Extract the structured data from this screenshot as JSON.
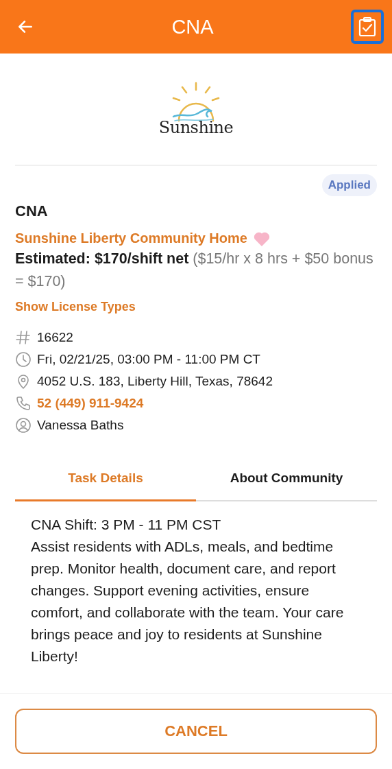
{
  "header": {
    "title": "CNA",
    "checklist_highlighted": true
  },
  "logo": {
    "text": "Sunshine"
  },
  "status_badge": "Applied",
  "job": {
    "title": "CNA",
    "community": "Sunshine Liberty Community Home",
    "favorite": true,
    "estimate": "**Estimated: $170/shift net** ($15/hr x 8 hrs + $50 bonus = $170)",
    "license_link": "Show License Types"
  },
  "details": [
    {
      "kind": "id",
      "text": "16622"
    },
    {
      "kind": "time",
      "text": "Fri, 02/21/25, 03:00 PM - 11:00 PM CT"
    },
    {
      "kind": "address",
      "text": "4052 U.S. 183, Liberty Hill, Texas, 78642"
    },
    {
      "kind": "phone",
      "text": "52 (449) 911-9424"
    },
    {
      "kind": "contact",
      "text": "Vanessa Baths"
    }
  ],
  "tabs": [
    {
      "label": "Task Details",
      "selected": true
    },
    {
      "label": "About Community",
      "selected": false
    }
  ],
  "description": [
    "CNA Shift: 3 PM - 11 PM CST",
    "Assist residents with ADLs, meals, and bedtime prep. Monitor health, document care, and report changes. Support evening activities, ensure comfort, and collaborate with the team. Your care brings peace and joy to residents at Sunshine Liberty!"
  ],
  "cancel_button": "CANCEL"
}
